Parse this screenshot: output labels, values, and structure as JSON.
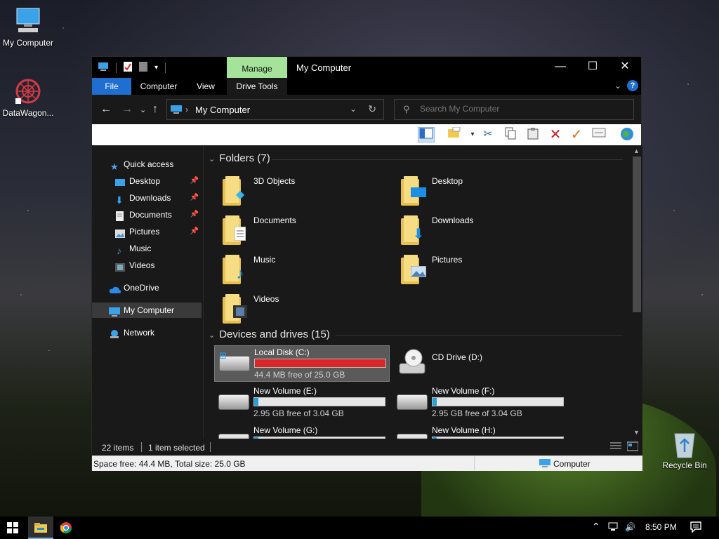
{
  "desktop": {
    "icons": [
      {
        "label": "My Computer"
      },
      {
        "label": "DataWagon..."
      },
      {
        "label": "Recycle Bin"
      }
    ]
  },
  "window": {
    "title": "My Computer",
    "manage_tab": "Manage",
    "ribbon_tabs": [
      "File",
      "Computer",
      "View",
      "Drive Tools"
    ],
    "help": "?",
    "address": {
      "text": "My Computer"
    },
    "search": {
      "placeholder": "Search My Computer"
    }
  },
  "nav": {
    "quick_access": "Quick access",
    "pinned": [
      "Desktop",
      "Downloads",
      "Documents",
      "Pictures"
    ],
    "unpinned": [
      "Music",
      "Videos"
    ],
    "onedrive": "OneDrive",
    "my_computer": "My Computer",
    "network": "Network"
  },
  "content": {
    "folders_header": "Folders (7)",
    "folders": [
      {
        "name": "3D Objects",
        "icon": "cube-icon"
      },
      {
        "name": "Desktop",
        "icon": "monitor-icon"
      },
      {
        "name": "Documents",
        "icon": "document-icon"
      },
      {
        "name": "Downloads",
        "icon": "download-arrow-icon"
      },
      {
        "name": "Music",
        "icon": "music-note-icon"
      },
      {
        "name": "Pictures",
        "icon": "landscape-icon"
      },
      {
        "name": "Videos",
        "icon": "film-icon"
      }
    ],
    "drives_header": "Devices and drives (15)",
    "drives": [
      {
        "name": "Local Disk (C:)",
        "free": "44.4 MB free of 25.0 GB",
        "used_fraction": 0.998,
        "color": "#da2626",
        "selected": true
      },
      {
        "name": "CD Drive (D:)",
        "free": "",
        "used_fraction": null,
        "color": "",
        "selected": false
      },
      {
        "name": "New Volume (E:)",
        "free": "2.95 GB free of 3.04 GB",
        "used_fraction": 0.03,
        "color": "#26a0da",
        "selected": false
      },
      {
        "name": "New Volume (F:)",
        "free": "2.95 GB free of 3.04 GB",
        "used_fraction": 0.03,
        "color": "#26a0da",
        "selected": false
      },
      {
        "name": "New Volume (G:)",
        "free": "",
        "used_fraction": 0.03,
        "color": "#26a0da",
        "selected": false
      },
      {
        "name": "New Volume (H:)",
        "free": "",
        "used_fraction": 0.03,
        "color": "#26a0da",
        "selected": false
      }
    ]
  },
  "status": {
    "items": "22 items",
    "selected": "1 item selected",
    "space": "Space free: 44.4 MB, Total size: 25.0 GB",
    "location": "Computer"
  },
  "taskbar": {
    "clock": "8:50 PM"
  },
  "colors": {
    "accent": "#1f6fd1",
    "manage": "#a6e39a",
    "full_drive": "#da2626",
    "drive_bar": "#26a0da"
  }
}
